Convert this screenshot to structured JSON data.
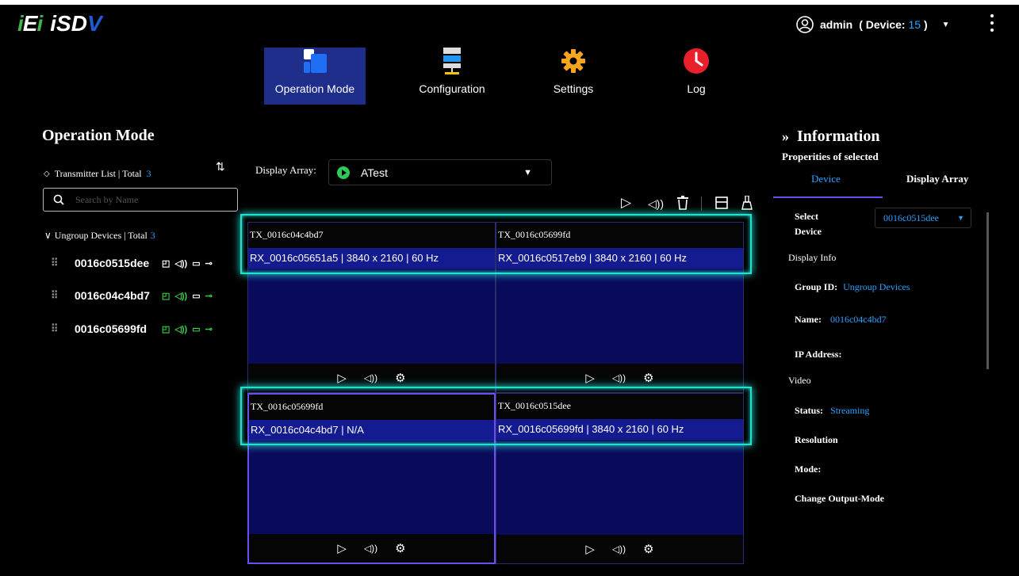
{
  "header": {
    "logo_iei": "iEi",
    "logo_isdv": "iSDV",
    "user_name": "admin",
    "device_label": "( Device: ",
    "device_count": "15",
    "device_close": " )"
  },
  "nav": [
    {
      "label": "Operation Mode",
      "active": true
    },
    {
      "label": "Configuration",
      "active": false
    },
    {
      "label": "Settings",
      "active": false
    },
    {
      "label": "Log",
      "active": false
    }
  ],
  "left": {
    "title": "Operation Mode",
    "tx_list_label": "Transmitter List | Total",
    "tx_total": "3",
    "search_placeholder": "Search by Name",
    "ungroup_label": "Ungroup Devices | Total",
    "ungroup_total": "3",
    "devices": [
      {
        "name": "0016c0515dee",
        "status_color": "#ffffff"
      },
      {
        "name": "0016c04c4bd7",
        "status_color": "#34d24a"
      },
      {
        "name": "0016c05699fd",
        "status_color": "#34d24a"
      }
    ]
  },
  "display_array": {
    "label": "Display Array:",
    "selected": "ATest"
  },
  "grid": [
    {
      "tx": "TX_0016c04c4bd7",
      "rx": "RX_0016c05651a5 | 3840 x 2160 | 60 Hz"
    },
    {
      "tx": "TX_0016c05699fd",
      "rx": "RX_0016c0517eb9 | 3840 x 2160 | 60 Hz"
    },
    {
      "tx": "TX_0016c05699fd",
      "rx": "RX_0016c04c4bd7 | N/A"
    },
    {
      "tx": "TX_0016c0515dee",
      "rx": "RX_0016c05699fd | 3840 x 2160 | 60 Hz"
    }
  ],
  "info": {
    "title": "Information",
    "props_label": "Properities of selected",
    "tab_device": "Device",
    "tab_display_array": "Display Array",
    "select_device_label_1": "Select",
    "select_device_label_2": "Device",
    "selected_device": "0016c0515dee",
    "display_info": "Display Info",
    "group_id_label": "Group ID:",
    "group_id_value": "Ungroup Devices",
    "name_label": "Name:",
    "name_value": "0016c04c4bd7",
    "ip_label": "IP Address:",
    "video_label": "Video",
    "status_label": "Status:",
    "status_value": "Streaming",
    "resolution_label": "Resolution",
    "mode_label": "Mode:",
    "change_output_label": "Change Output-Mode"
  },
  "colors": {
    "accent_blue": "#2aa3ff",
    "nav_active": "#1f2e8a",
    "tile_bg": "#0a0a5a",
    "rx_bar": "#141a8f",
    "highlight": "#22e0d2",
    "selection": "#6a4ef2",
    "green": "#34d24a"
  },
  "icons": [
    "user-circle-icon",
    "kebab-menu-icon",
    "operation-mode-icon",
    "configuration-icon",
    "settings-gear-icon",
    "log-clock-icon",
    "sort-icon",
    "search-icon",
    "drag-handle-icon",
    "cast-icon",
    "audio-icon",
    "display-icon",
    "usb-icon",
    "play-icon",
    "trash-icon",
    "layout-icon",
    "clear-icon"
  ]
}
